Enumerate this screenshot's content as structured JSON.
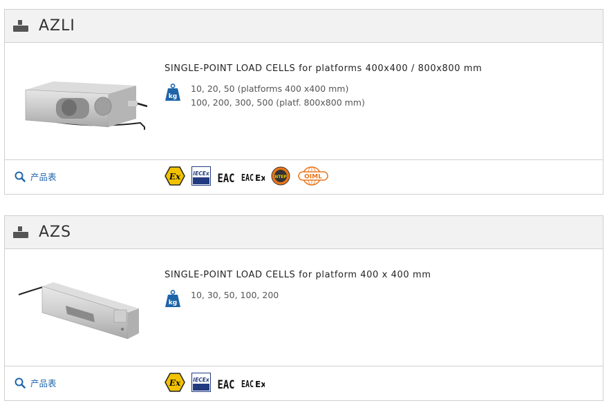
{
  "products": [
    {
      "name": "AZLI",
      "description": "SINGLE-POINT LOAD CELLS for platforms 400x400 / 800x800 mm",
      "capacity_lines": [
        "10, 20, 50  (platforms 400 x400 mm)",
        "100, 200, 300, 500  (platf. 800x800 mm)"
      ],
      "datasheet_label": "产品表",
      "certifications": [
        "atex-icon",
        "iecex-icon",
        "eac-icon",
        "eac-ex-icon",
        "ntep-icon",
        "oiml-icon"
      ]
    },
    {
      "name": "AZS",
      "description": "SINGLE-POINT LOAD CELLS for platform 400 x 400 mm",
      "capacity_lines": [
        "10, 30, 50, 100, 200"
      ],
      "datasheet_label": "产品表",
      "certifications": [
        "atex-icon",
        "iecex-icon",
        "eac-icon",
        "eac-ex-icon"
      ]
    }
  ],
  "labels": {
    "kg_badge": "kg",
    "iecex": "IECEx",
    "ntep": "NTEP",
    "oiml": "OIML",
    "eac": "EAC",
    "ex": "Ex"
  },
  "colors": {
    "link_blue": "#1e64a8",
    "atex_yellow": "#f2c200",
    "oiml_orange": "#e8751a",
    "header_bg": "#f2f2f2"
  }
}
